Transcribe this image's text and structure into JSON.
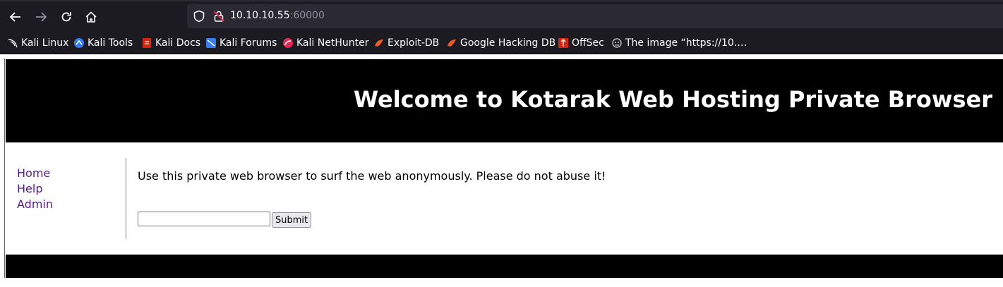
{
  "browser": {
    "url_host": "10.10.10.55",
    "url_port": ":60000",
    "bookmarks": [
      {
        "label": "Kali Linux",
        "icon": "kali-dragon-icon"
      },
      {
        "label": "Kali Tools",
        "icon": "kali-tools-icon"
      },
      {
        "label": "Kali Docs",
        "icon": "kali-docs-icon"
      },
      {
        "label": "Kali Forums",
        "icon": "kali-forums-icon"
      },
      {
        "label": "Kali NetHunter",
        "icon": "kali-nethunter-icon"
      },
      {
        "label": "Exploit-DB",
        "icon": "exploit-db-icon"
      },
      {
        "label": "Google Hacking DB",
        "icon": "ghdb-icon"
      },
      {
        "label": "OffSec",
        "icon": "offsec-icon"
      },
      {
        "label": "The image “https://10.…",
        "icon": "image-icon"
      }
    ]
  },
  "page": {
    "title": "Welcome to Kotarak Web Hosting Private Browser",
    "nav": [
      "Home",
      "Help",
      "Admin"
    ],
    "intro": "Use this private web browser to surf the web anonymously. Please do not abuse it!",
    "input_value": "",
    "submit_label": "Submit"
  },
  "colors": {
    "header_bg": "#000000",
    "link": "#551a8b",
    "chrome_bg": "#1c1b22"
  }
}
